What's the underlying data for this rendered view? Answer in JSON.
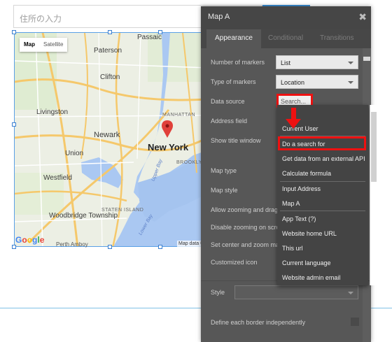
{
  "address_input": {
    "placeholder": "住所の入力"
  },
  "map": {
    "map_type_buttons": [
      "Map",
      "Satellite"
    ],
    "active_map_type": "Map",
    "labels": {
      "passaic": "Passaic",
      "paterson": "Paterson",
      "clifton": "Clifton",
      "livingston": "Livingston",
      "newark": "Newark",
      "union": "Union",
      "new_york": "New York",
      "manhattan": "MANHATTAN",
      "brooklyn": "BROOKLYN",
      "westfield": "Westfield",
      "staten_island": "STATEN ISLAND",
      "woodbridge": "Woodbridge Township",
      "perth_amboy": "Perth Amboy",
      "upper_bay": "Upper Bay",
      "lower_bay": "Lower Bay"
    },
    "google_logo": "Google",
    "attribution": "Map data ©"
  },
  "panel": {
    "title": "Map A",
    "close_symbol": "✖",
    "tabs": [
      "Appearance",
      "Conditional",
      "Transitions"
    ],
    "active_tab": "Appearance",
    "properties": {
      "number_of_markers": {
        "label": "Number of markers",
        "value": "List"
      },
      "type_of_markers": {
        "label": "Type of markers",
        "value": "Location"
      },
      "data_source": {
        "label": "Data source",
        "value": "Search..."
      },
      "address_field": {
        "label": "Address field"
      },
      "show_title_window": {
        "label": "Show title window"
      },
      "map_type": {
        "label": "Map type"
      },
      "map_style": {
        "label": "Map style"
      },
      "allow_zooming": {
        "label": "Allow zooming and drag"
      },
      "disable_zooming": {
        "label": "Disable zooming on scro"
      },
      "set_center": {
        "label": "Set center and zoom ma"
      },
      "customized_icon": {
        "label": "Customized icon"
      },
      "style": {
        "label": "Style",
        "value": ""
      },
      "define_border": {
        "label": "Define each border independently"
      }
    }
  },
  "dropdown": {
    "items": [
      "Current User",
      "Do a search for",
      "Get data from an external API",
      "Calculate formula",
      "Input Address",
      "Map A",
      "App Text (?)",
      "Website home URL",
      "This url",
      "Current language",
      "Website admin email"
    ],
    "highlighted": "Do a search for"
  },
  "colors": {
    "panel_bg": "#575757",
    "dropdown_bg": "#444444",
    "highlight_red": "#ee1111",
    "map_border": "#5aa0e6"
  }
}
